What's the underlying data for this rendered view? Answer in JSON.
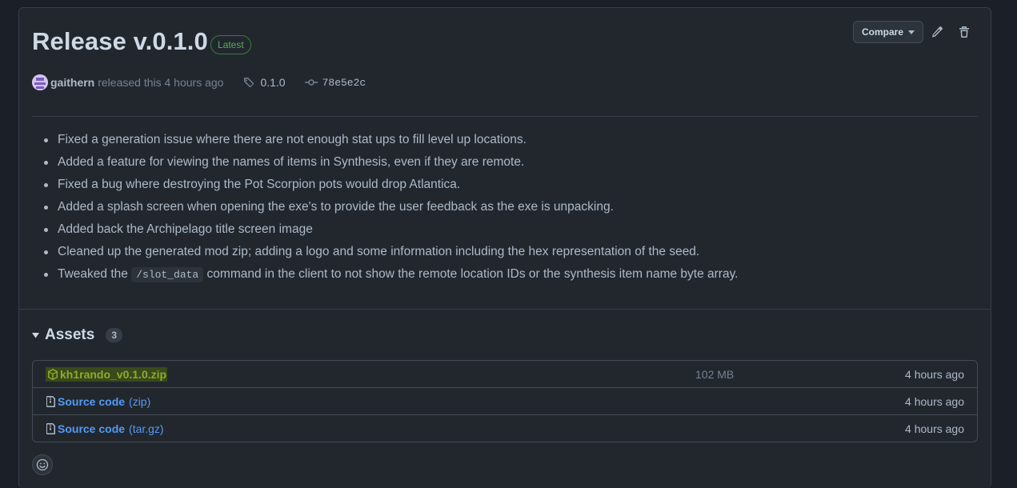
{
  "release": {
    "title": "Release v.0.1.0",
    "badge": "Latest",
    "author": "gaithern",
    "released_text": "released this 4 hours ago",
    "tag": "0.1.0",
    "commit": "78e5e2c"
  },
  "toolbar": {
    "compare_label": "Compare",
    "edit_icon": "pencil-icon",
    "delete_icon": "trash-icon"
  },
  "notes": [
    {
      "text": "Fixed a generation issue where there are not enough stat ups to fill level up locations."
    },
    {
      "text": "Added a feature for viewing the names of items in Synthesis, even if they are remote."
    },
    {
      "text": "Fixed a bug where destroying the Pot Scorpion pots would drop Atlantica."
    },
    {
      "text": "Added a splash screen when opening the exe's to provide the user feedback as the exe is unpacking."
    },
    {
      "text": "Added back the Archipelago title screen image"
    },
    {
      "text": "Cleaned up the generated mod zip; adding a logo and some information including the hex representation of the seed."
    },
    {
      "before": "Tweaked the",
      "code": "/slot_data",
      "after": "command in the client to not show the remote location IDs or the synthesis item name byte array."
    }
  ],
  "assets": {
    "title": "Assets",
    "count": "3",
    "items": [
      {
        "name": "kh1rando_v0.1.0.zip",
        "size": "102 MB",
        "time": "4 hours ago",
        "icon": "package-icon"
      },
      {
        "name": "Source code",
        "suffix": "(zip)",
        "time": "4 hours ago",
        "icon": "file-zip-icon"
      },
      {
        "name": "Source code",
        "suffix": "(tar.gz)",
        "time": "4 hours ago",
        "icon": "file-zip-icon"
      }
    ]
  },
  "colors": {
    "background": "#1b2028",
    "card": "#22272e",
    "link": "#539bf5",
    "latest_green": "#57ab5a"
  }
}
